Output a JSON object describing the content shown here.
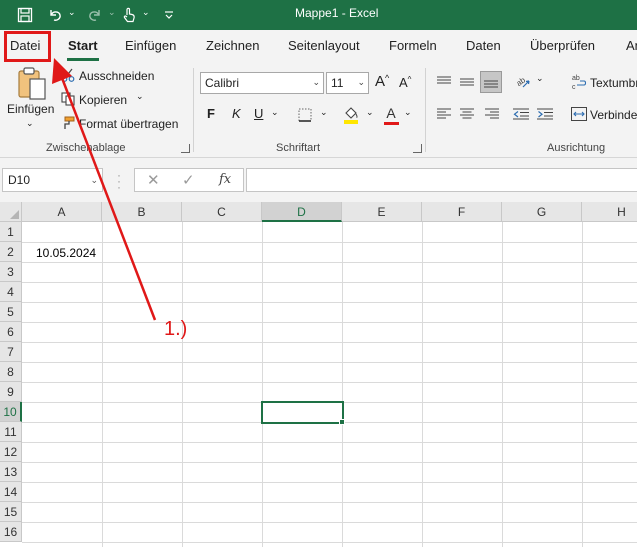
{
  "window": {
    "title": "Mappe1  -  Excel"
  },
  "qat": {
    "save_icon": "save-icon",
    "undo_icon": "undo-icon",
    "redo_icon": "redo-icon",
    "touch_icon": "touch-mode-icon",
    "customize_icon": "customize-qat-icon"
  },
  "tabs": [
    {
      "label": "Datei"
    },
    {
      "label": "Start"
    },
    {
      "label": "Einfügen"
    },
    {
      "label": "Zeichnen"
    },
    {
      "label": "Seitenlayout"
    },
    {
      "label": "Formeln"
    },
    {
      "label": "Daten"
    },
    {
      "label": "Überprüfen"
    },
    {
      "label": "An"
    }
  ],
  "clipboard": {
    "paste_label": "Einfügen",
    "cut_label": "Ausschneiden",
    "copy_label": "Kopieren",
    "format_painter_label": "Format übertragen",
    "group_label": "Zwischenablage"
  },
  "font": {
    "font_name": "Calibri",
    "font_size": "11",
    "grow_label": "A",
    "shrink_label": "A",
    "bold_label": "F",
    "italic_label": "K",
    "underline_label": "U",
    "font_color_label": "A",
    "group_label": "Schriftart"
  },
  "alignment": {
    "wrap_text_label": "Textumbr",
    "merge_label": "Verbinder",
    "group_label": "Ausrichtung"
  },
  "formula_bar": {
    "name_box": "D10",
    "fx_label": "fx",
    "value": ""
  },
  "sheet": {
    "columns": [
      "A",
      "B",
      "C",
      "D",
      "E",
      "F",
      "G",
      "H"
    ],
    "rows": [
      "1",
      "2",
      "3",
      "4",
      "5",
      "6",
      "7",
      "8",
      "9",
      "10",
      "11",
      "12",
      "13",
      "14",
      "15",
      "16"
    ],
    "selected_column": "D",
    "selected_row": "10",
    "cells": {
      "A2": "10.05.2024"
    }
  },
  "annotation": {
    "label": "1.)",
    "color": "#e01818"
  },
  "colors": {
    "excel_green": "#1e7145",
    "annotation_red": "#e01818"
  }
}
